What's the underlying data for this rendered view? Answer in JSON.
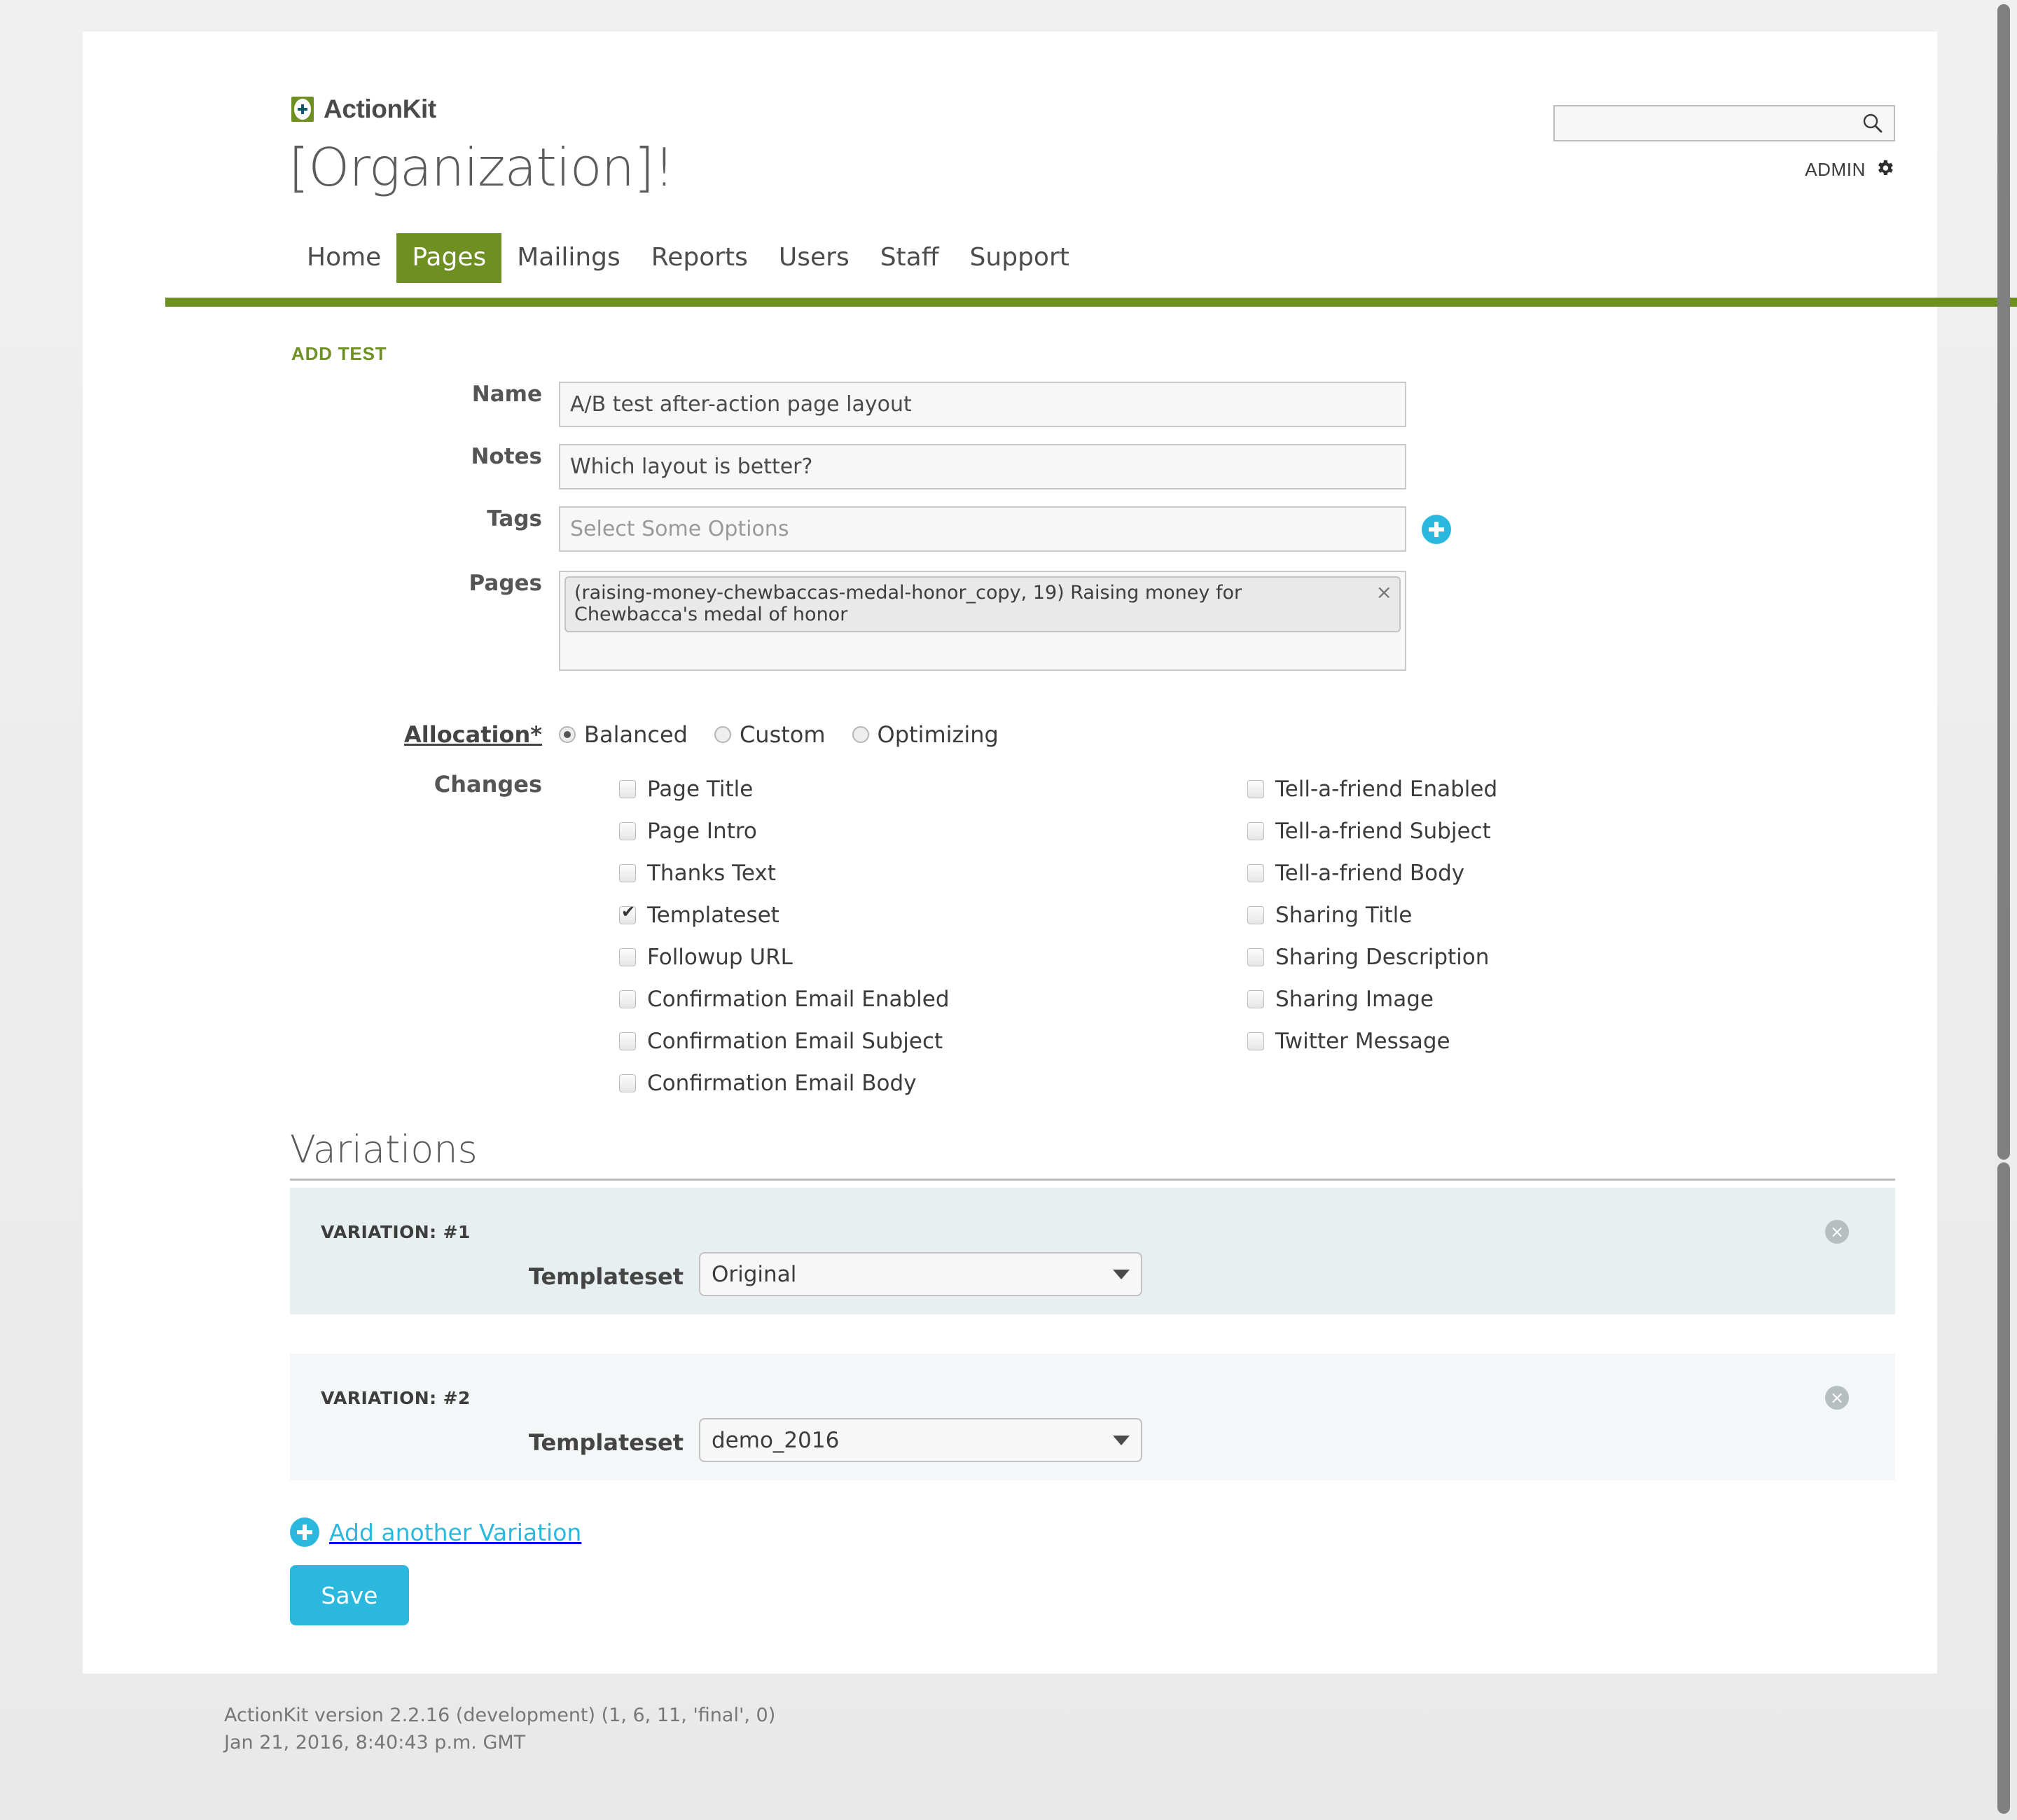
{
  "brand": {
    "name": "ActionKit",
    "logo_icon": "plus-badge-icon",
    "accent_green": "#6e9022",
    "accent_cyan": "#2bb8de"
  },
  "header": {
    "org_title": "[Organization]!",
    "search": {
      "value": "",
      "placeholder": "",
      "icon": "search-icon"
    },
    "admin": {
      "label": "ADMIN",
      "icon": "gear-icon"
    }
  },
  "nav": {
    "tabs": [
      {
        "label": "Home",
        "active": false
      },
      {
        "label": "Pages",
        "active": true
      },
      {
        "label": "Mailings",
        "active": false
      },
      {
        "label": "Reports",
        "active": false
      },
      {
        "label": "Users",
        "active": false
      },
      {
        "label": "Staff",
        "active": false
      },
      {
        "label": "Support",
        "active": false
      }
    ]
  },
  "form": {
    "heading": "ADD TEST",
    "name": {
      "label": "Name",
      "value": "A/B test after-action page layout",
      "placeholder": ""
    },
    "notes": {
      "label": "Notes",
      "value": "Which layout is better?",
      "placeholder": ""
    },
    "tags": {
      "label": "Tags",
      "value": "",
      "placeholder": "Select Some Options",
      "add_icon": "plus-circle-icon"
    },
    "pages": {
      "label": "Pages",
      "chip_text": "(raising-money-chewbaccas-medal-honor_copy, 19) Raising money for Chewbacca's medal of honor",
      "chip_remove_icon": "×"
    },
    "allocation": {
      "label": "Allocation*",
      "options": [
        {
          "label": "Balanced",
          "selected": true
        },
        {
          "label": "Custom",
          "selected": false
        },
        {
          "label": "Optimizing",
          "selected": false
        }
      ]
    },
    "changes": {
      "label": "Changes",
      "left_column": [
        {
          "label": "Page Title",
          "checked": false
        },
        {
          "label": "Page Intro",
          "checked": false
        },
        {
          "label": "Thanks Text",
          "checked": false
        },
        {
          "label": "Templateset",
          "checked": true
        },
        {
          "label": "Followup URL",
          "checked": false
        },
        {
          "label": "Confirmation Email Enabled",
          "checked": false
        },
        {
          "label": "Confirmation Email Subject",
          "checked": false
        },
        {
          "label": "Confirmation Email Body",
          "checked": false
        }
      ],
      "right_column": [
        {
          "label": "Tell-a-friend Enabled",
          "checked": false
        },
        {
          "label": "Tell-a-friend Subject",
          "checked": false
        },
        {
          "label": "Tell-a-friend Body",
          "checked": false
        },
        {
          "label": "Sharing Title",
          "checked": false
        },
        {
          "label": "Sharing Description",
          "checked": false
        },
        {
          "label": "Sharing Image",
          "checked": false
        },
        {
          "label": "Twitter Message",
          "checked": false
        }
      ]
    }
  },
  "variations": {
    "heading": "Variations",
    "items": [
      {
        "label": "VARIATION: #1",
        "field_label": "Templateset",
        "value": "Original",
        "remove_icon": "×"
      },
      {
        "label": "VARIATION: #2",
        "field_label": "Templateset",
        "value": "demo_2016",
        "remove_icon": "×"
      }
    ],
    "add_label": "Add another Variation",
    "add_icon": "plus-circle-icon"
  },
  "actions": {
    "save_label": "Save"
  },
  "footer": {
    "version_line": "ActionKit version 2.2.16 (development) (1, 6, 11, 'final', 0)",
    "timestamp_line": "Jan 21, 2016, 8:40:43 p.m. GMT"
  }
}
